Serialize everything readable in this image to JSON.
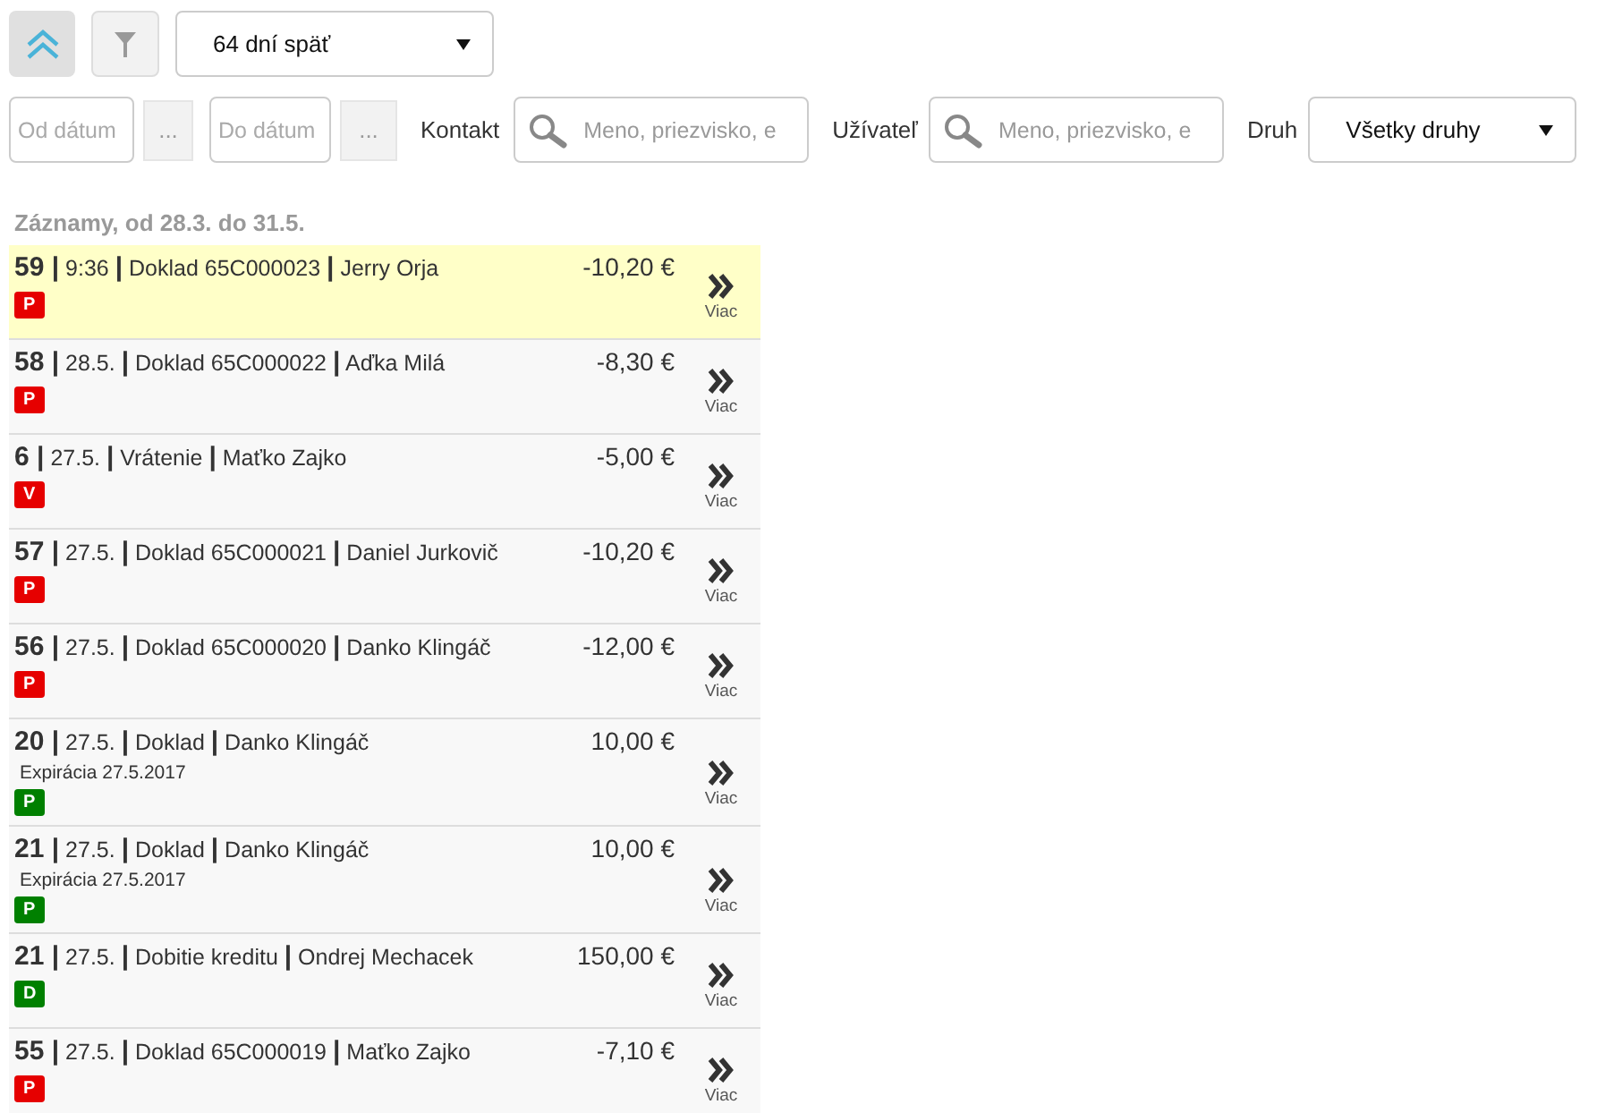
{
  "toolbar": {
    "period_select": "64 dní späť"
  },
  "filters": {
    "date_from": {
      "placeholder": "Od dátum"
    },
    "date_from_button": "...",
    "date_to": {
      "placeholder": "Do dátum"
    },
    "date_to_button": "...",
    "contact_label": "Kontakt",
    "contact_search": {
      "placeholder": "Meno, priezvisko, e"
    },
    "user_label": "Užívateľ",
    "user_search": {
      "placeholder": "Meno, priezvisko, e"
    },
    "type_label": "Druh",
    "type_select": "Všetky druhy"
  },
  "records_heading": "Záznamy, od 28.3. do 31.5.",
  "records": [
    {
      "title": "**59 |** 9:36 **|** Doklad 65C000023 **|** Jerry Orja",
      "amount": "-10,20 €",
      "badge": "P",
      "color": "#e60000",
      "selected": true,
      "more": "Viac"
    },
    {
      "title": "**58 |** 28.5. **|** Doklad 65C000022 **|** Aďka Milá",
      "amount": "-8,30 €",
      "badge": "P",
      "color": "#e60000",
      "selected": false,
      "more": "Viac"
    },
    {
      "title": "**6 |** 27.5. **|** Vrátenie **|** Maťko Zajko",
      "amount": "-5,00 €",
      "badge": "V",
      "color": "#e60000",
      "selected": false,
      "more": "Viac"
    },
    {
      "title": "**57 |** 27.5. **|** Doklad 65C000021 **|** Daniel Jurkovič",
      "amount": "-10,20 €",
      "badge": "P",
      "color": "#e60000",
      "selected": false,
      "more": "Viac"
    },
    {
      "title": "**56 |** 27.5. **|** Doklad 65C000020 **|** Danko Klingáč",
      "amount": "-12,00 €",
      "badge": "P",
      "color": "#e60000",
      "selected": false,
      "more": "Viac"
    },
    {
      "title": "**20 |** 27.5. **|** Doklad **|** Danko Klingáč",
      "expiration": "Expirácia 27.5.2017",
      "amount": "10,00 €",
      "badge": "P",
      "color": "#008000",
      "selected": false,
      "more": "Viac"
    },
    {
      "title": "**21 |** 27.5. **|** Doklad **|** Danko Klingáč",
      "expiration": "Expirácia 27.5.2017",
      "amount": "10,00 €",
      "badge": "P",
      "color": "#008000",
      "selected": false,
      "more": "Viac"
    },
    {
      "title": "**21 |** 27.5. **|** Dobitie kreditu **|** Ondrej Mechacek",
      "amount": "150,00 €",
      "badge": "D",
      "color": "#008000",
      "selected": false,
      "more": "Viac"
    },
    {
      "title": "**55 |** 27.5. **|** Doklad 65C000019 **|** Maťko Zajko",
      "amount": "-7,10 €",
      "badge": "P",
      "color": "#e60000",
      "selected": false,
      "more": "Viac"
    }
  ]
}
